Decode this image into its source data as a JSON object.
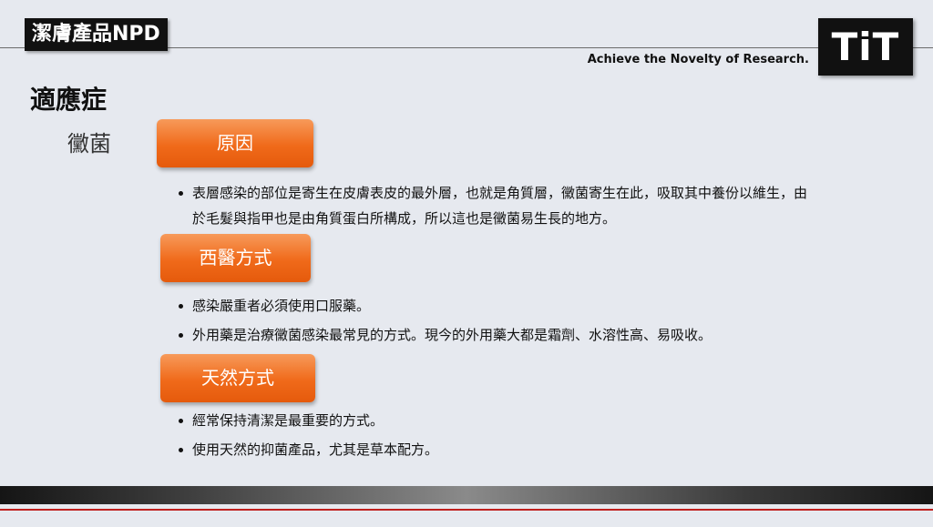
{
  "header": {
    "tag": "潔膚產品NPD",
    "logo": "TiT",
    "tagline": "Achieve the Novelty of Research."
  },
  "page": {
    "title": "適應症",
    "subtitle": "黴菌"
  },
  "sections": [
    {
      "heading": "原因",
      "bullets": [
        "表層感染的部位是寄生在皮膚表皮的最外層，也就是角質層，黴菌寄生在此，吸取其中養份以維生，由於毛髮與指甲也是由角質蛋白所構成，所以這也是黴菌易生長的地方。"
      ]
    },
    {
      "heading": "西醫方式",
      "bullets": [
        "感染嚴重者必須使用口服藥。",
        "外用藥是治療黴菌感染最常見的方式。現今的外用藥大都是霜劑、水溶性高、易吸收。"
      ]
    },
    {
      "heading": "天然方式",
      "bullets": [
        "經常保持清潔是最重要的方式。",
        "使用天然的抑菌產品，尤其是草本配方。"
      ]
    }
  ],
  "colors": {
    "accent_orange": "#f06a1a",
    "bar_red": "#c0201e",
    "background": "#e6e9ef"
  }
}
